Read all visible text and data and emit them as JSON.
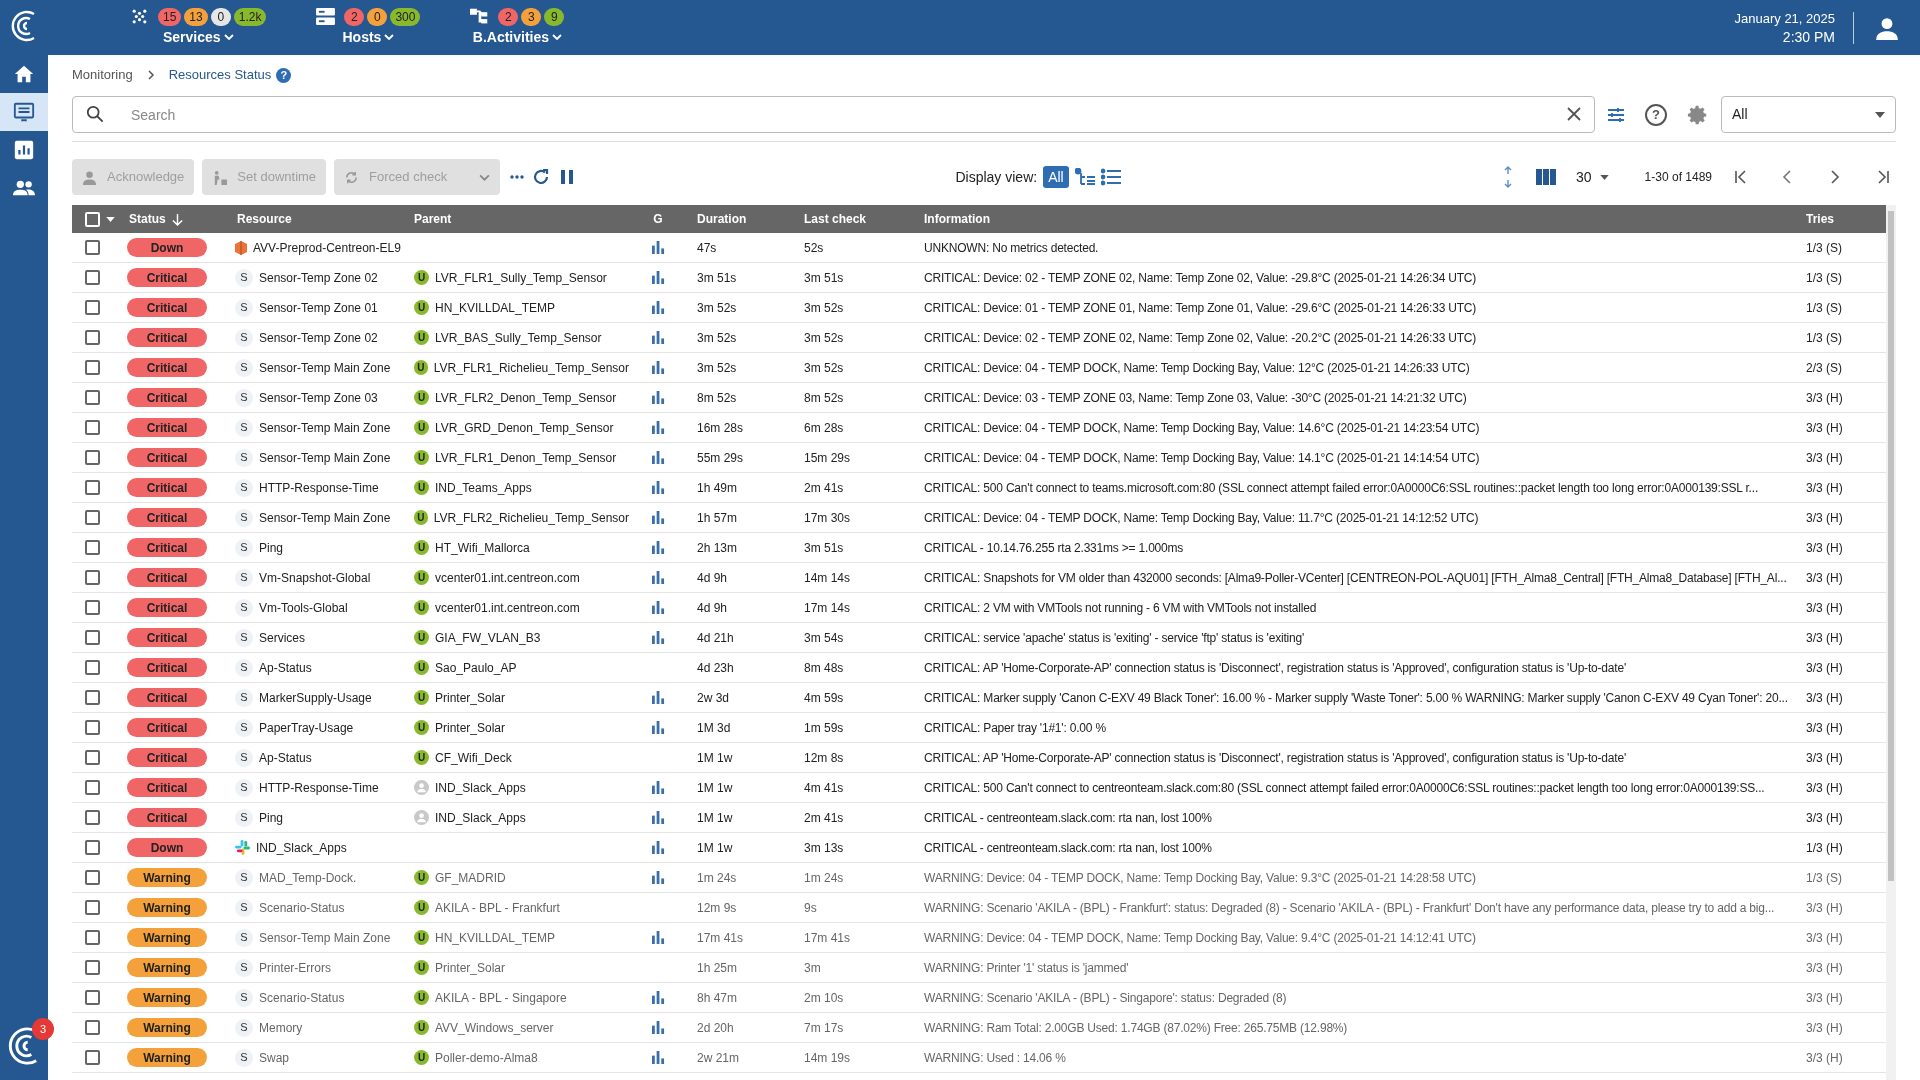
{
  "header": {
    "groups": [
      {
        "kind": "services",
        "label": "Services",
        "counters": [
          {
            "value": "15",
            "color": "#f06565"
          },
          {
            "value": "13",
            "color": "#f5a13b"
          },
          {
            "value": "0",
            "color": "#e6e6e6"
          },
          {
            "value": "1.2k",
            "color": "#88b92c"
          }
        ]
      },
      {
        "kind": "hosts",
        "label": "Hosts",
        "counters": [
          {
            "value": "2",
            "color": "#f06565"
          },
          {
            "value": "0",
            "color": "#f5a13b"
          },
          {
            "value": "300",
            "color": "#88b92c"
          }
        ]
      },
      {
        "kind": "activities",
        "label": "B.Activities",
        "counters": [
          {
            "value": "2",
            "color": "#f06565"
          },
          {
            "value": "3",
            "color": "#f5a13b"
          },
          {
            "value": "9",
            "color": "#88b92c"
          }
        ]
      }
    ],
    "date": "January 21, 2025",
    "time": "2:30 PM"
  },
  "sidebar": {
    "items": [
      {
        "kind": "home",
        "selected": false
      },
      {
        "kind": "monitoring",
        "selected": true
      },
      {
        "kind": "reporting",
        "selected": false
      },
      {
        "kind": "users",
        "selected": false
      }
    ],
    "badge": "3"
  },
  "breadcrumb": {
    "items": [
      "Monitoring",
      "Resources Status"
    ],
    "help": "?"
  },
  "search": {
    "placeholder": "Search",
    "help": "?",
    "filter": "All"
  },
  "actions": [
    "Acknowledge",
    "Set downtime",
    "Forced check"
  ],
  "display_view": {
    "label": "Display view:",
    "options": [
      {
        "kind": "all",
        "label": "All",
        "selected": true
      },
      {
        "kind": "tree",
        "selected": false
      },
      {
        "kind": "list",
        "selected": false
      }
    ]
  },
  "pagination": {
    "per_page": "30",
    "range": "1-30 of 1489"
  },
  "table": {
    "select_all": {
      "checked": false
    },
    "columns": [
      "Status",
      "Resource",
      "Parent",
      "G",
      "Duration",
      "Last check",
      "Information",
      "Tries"
    ],
    "rows": [
      {
        "checked": false,
        "status": {
          "label": "Down",
          "color": "#f06565"
        },
        "resource": {
          "kind": "host",
          "name": "AVV-Preprod-Centreon-EL9"
        },
        "graph": true,
        "duration": "47s",
        "last_check": "52s",
        "information": "UNKNOWN: No metrics detected.",
        "tries": "1/3 (S)"
      },
      {
        "checked": false,
        "status": {
          "label": "Critical",
          "color": "#f06565"
        },
        "resource": {
          "kind": "service",
          "badge": "S",
          "name": "Sensor-Temp Zone 02"
        },
        "parent": {
          "kind": "up",
          "badge": "U",
          "name": "LVR_FLR1_Sully_Temp_Sensor"
        },
        "graph": true,
        "duration": "3m 51s",
        "last_check": "3m 51s",
        "information": "CRITICAL: Device: 02 - TEMP ZONE 02, Name: Temp Zone 02, Value: -29.8°C (2025-01-21 14:26:34 UTC)",
        "tries": "1/3 (S)"
      },
      {
        "checked": false,
        "status": {
          "label": "Critical",
          "color": "#f06565"
        },
        "resource": {
          "kind": "service",
          "badge": "S",
          "name": "Sensor-Temp Zone 01"
        },
        "parent": {
          "kind": "up",
          "badge": "U",
          "name": "HN_KVILLDAL_TEMP"
        },
        "graph": true,
        "duration": "3m 52s",
        "last_check": "3m 52s",
        "information": "CRITICAL: Device: 01 - TEMP ZONE 01, Name: Temp Zone 01, Value: -29.6°C (2025-01-21 14:26:33 UTC)",
        "tries": "1/3 (S)"
      },
      {
        "checked": false,
        "status": {
          "label": "Critical",
          "color": "#f06565"
        },
        "resource": {
          "kind": "service",
          "badge": "S",
          "name": "Sensor-Temp Zone 02"
        },
        "parent": {
          "kind": "up",
          "badge": "U",
          "name": "LVR_BAS_Sully_Temp_Sensor"
        },
        "graph": true,
        "duration": "3m 52s",
        "last_check": "3m 52s",
        "information": "CRITICAL: Device: 02 - TEMP ZONE 02, Name: Temp Zone 02, Value: -20.2°C (2025-01-21 14:26:33 UTC)",
        "tries": "1/3 (S)"
      },
      {
        "checked": false,
        "status": {
          "label": "Critical",
          "color": "#f06565"
        },
        "resource": {
          "kind": "service",
          "badge": "S",
          "name": "Sensor-Temp Main Zone"
        },
        "parent": {
          "kind": "up",
          "badge": "U",
          "name": "LVR_FLR1_Richelieu_Temp_Sensor"
        },
        "graph": true,
        "duration": "3m 52s",
        "last_check": "3m 52s",
        "information": "CRITICAL: Device: 04 - TEMP DOCK, Name: Temp Docking Bay, Value: 12°C (2025-01-21 14:26:33 UTC)",
        "tries": "2/3 (S)"
      },
      {
        "checked": false,
        "status": {
          "label": "Critical",
          "color": "#f06565"
        },
        "resource": {
          "kind": "service",
          "badge": "S",
          "name": "Sensor-Temp Zone 03"
        },
        "parent": {
          "kind": "up",
          "badge": "U",
          "name": "LVR_FLR2_Denon_Temp_Sensor"
        },
        "graph": true,
        "duration": "8m 52s",
        "last_check": "8m 52s",
        "information": "CRITICAL: Device: 03 - TEMP ZONE 03, Name: Temp Zone 03, Value: -30°C (2025-01-21 14:21:32 UTC)",
        "tries": "3/3 (H)"
      },
      {
        "checked": false,
        "status": {
          "label": "Critical",
          "color": "#f06565"
        },
        "resource": {
          "kind": "service",
          "badge": "S",
          "name": "Sensor-Temp Main Zone"
        },
        "parent": {
          "kind": "up",
          "badge": "U",
          "name": "LVR_GRD_Denon_Temp_Sensor"
        },
        "graph": true,
        "duration": "16m 28s",
        "last_check": "6m 28s",
        "information": "CRITICAL: Device: 04 - TEMP DOCK, Name: Temp Docking Bay, Value: 14.6°C (2025-01-21 14:23:54 UTC)",
        "tries": "3/3 (H)"
      },
      {
        "checked": false,
        "status": {
          "label": "Critical",
          "color": "#f06565"
        },
        "resource": {
          "kind": "service",
          "badge": "S",
          "name": "Sensor-Temp Main Zone"
        },
        "parent": {
          "kind": "up",
          "badge": "U",
          "name": "LVR_FLR1_Denon_Temp_Sensor"
        },
        "graph": true,
        "duration": "55m 29s",
        "last_check": "15m 29s",
        "information": "CRITICAL: Device: 04 - TEMP DOCK, Name: Temp Docking Bay, Value: 14.1°C (2025-01-21 14:14:54 UTC)",
        "tries": "3/3 (H)"
      },
      {
        "checked": false,
        "status": {
          "label": "Critical",
          "color": "#f06565"
        },
        "resource": {
          "kind": "service",
          "badge": "S",
          "name": "HTTP-Response-Time"
        },
        "parent": {
          "kind": "up",
          "badge": "U",
          "name": "IND_Teams_Apps"
        },
        "graph": true,
        "duration": "1h 49m",
        "last_check": "2m 41s",
        "information": "CRITICAL: 500 Can't connect to teams.microsoft.com:80 (SSL connect attempt failed error:0A0000C6:SSL routines::packet length too long error:0A000139:SSL r...",
        "tries": "3/3 (H)"
      },
      {
        "checked": false,
        "status": {
          "label": "Critical",
          "color": "#f06565"
        },
        "resource": {
          "kind": "service",
          "badge": "S",
          "name": "Sensor-Temp Main Zone"
        },
        "parent": {
          "kind": "up",
          "badge": "U",
          "name": "LVR_FLR2_Richelieu_Temp_Sensor"
        },
        "graph": true,
        "duration": "1h 57m",
        "last_check": "17m 30s",
        "information": "CRITICAL: Device: 04 - TEMP DOCK, Name: Temp Docking Bay, Value: 11.7°C (2025-01-21 14:12:52 UTC)",
        "tries": "3/3 (H)"
      },
      {
        "checked": false,
        "status": {
          "label": "Critical",
          "color": "#f06565"
        },
        "resource": {
          "kind": "service",
          "badge": "S",
          "name": "Ping"
        },
        "parent": {
          "kind": "up",
          "badge": "U",
          "name": "HT_Wifi_Mallorca"
        },
        "graph": true,
        "duration": "2h 13m",
        "last_check": "3m 51s",
        "information": "CRITICAL - 10.14.76.255 rta 2.331ms >= 1.000ms",
        "tries": "3/3 (H)"
      },
      {
        "checked": false,
        "status": {
          "label": "Critical",
          "color": "#f06565"
        },
        "resource": {
          "kind": "service",
          "badge": "S",
          "name": "Vm-Snapshot-Global"
        },
        "parent": {
          "kind": "up",
          "badge": "U",
          "name": "vcenter01.int.centreon.com"
        },
        "graph": true,
        "duration": "4d 9h",
        "last_check": "14m 14s",
        "information": "CRITICAL: Snapshots for VM older than 432000 seconds: [Alma9-Poller-VCenter] [CENTREON-POL-AQU01] [FTH_Alma8_Central] [FTH_Alma8_Database] [FTH_Al...",
        "tries": "3/3 (H)"
      },
      {
        "checked": false,
        "status": {
          "label": "Critical",
          "color": "#f06565"
        },
        "resource": {
          "kind": "service",
          "badge": "S",
          "name": "Vm-Tools-Global"
        },
        "parent": {
          "kind": "up",
          "badge": "U",
          "name": "vcenter01.int.centreon.com"
        },
        "graph": true,
        "duration": "4d 9h",
        "last_check": "17m 14s",
        "information": "CRITICAL: 2 VM with VMTools not running - 6 VM with VMTools not installed",
        "tries": "3/3 (H)"
      },
      {
        "checked": false,
        "status": {
          "label": "Critical",
          "color": "#f06565"
        },
        "resource": {
          "kind": "service",
          "badge": "S",
          "name": "Services"
        },
        "parent": {
          "kind": "up",
          "badge": "U",
          "name": "GIA_FW_VLAN_B3"
        },
        "graph": true,
        "duration": "4d 21h",
        "last_check": "3m 54s",
        "information": "CRITICAL: service 'apache' status is 'exiting' - service 'ftp' status is 'exiting'",
        "tries": "3/3 (H)"
      },
      {
        "checked": false,
        "status": {
          "label": "Critical",
          "color": "#f06565"
        },
        "resource": {
          "kind": "service",
          "badge": "S",
          "name": "Ap-Status"
        },
        "parent": {
          "kind": "up",
          "badge": "U",
          "name": "Sao_Paulo_AP"
        },
        "graph": false,
        "duration": "4d 23h",
        "last_check": "8m 48s",
        "information": "CRITICAL: AP 'Home-Corporate-AP' connection status is 'Disconnect', registration status is 'Approved', configuration status is 'Up-to-date'",
        "tries": "3/3 (H)"
      },
      {
        "checked": false,
        "status": {
          "label": "Critical",
          "color": "#f06565"
        },
        "resource": {
          "kind": "service",
          "badge": "S",
          "name": "MarkerSupply-Usage"
        },
        "parent": {
          "kind": "up",
          "badge": "U",
          "name": "Printer_Solar"
        },
        "graph": true,
        "duration": "2w 3d",
        "last_check": "4m 59s",
        "information": "CRITICAL: Marker supply 'Canon C-EXV 49 Black Toner': 16.00 % - Marker supply 'Waste Toner': 5.00 % WARNING: Marker supply 'Canon C-EXV 49 Cyan Toner': 20...",
        "tries": "3/3 (H)"
      },
      {
        "checked": false,
        "status": {
          "label": "Critical",
          "color": "#f06565"
        },
        "resource": {
          "kind": "service",
          "badge": "S",
          "name": "PaperTray-Usage"
        },
        "parent": {
          "kind": "up",
          "badge": "U",
          "name": "Printer_Solar"
        },
        "graph": true,
        "duration": "1M 3d",
        "last_check": "1m 59s",
        "information": "CRITICAL: Paper tray '1#1': 0.00 %",
        "tries": "3/3 (H)"
      },
      {
        "checked": false,
        "status": {
          "label": "Critical",
          "color": "#f06565"
        },
        "resource": {
          "kind": "service",
          "badge": "S",
          "name": "Ap-Status"
        },
        "parent": {
          "kind": "up",
          "badge": "U",
          "name": "CF_Wifi_Deck"
        },
        "graph": false,
        "duration": "1M 1w",
        "last_check": "12m 8s",
        "information": "CRITICAL: AP 'Home-Corporate-AP' connection status is 'Disconnect', registration status is 'Approved', configuration status is 'Up-to-date'",
        "tries": "3/3 (H)"
      },
      {
        "checked": false,
        "status": {
          "label": "Critical",
          "color": "#f06565"
        },
        "resource": {
          "kind": "service",
          "badge": "S",
          "name": "HTTP-Response-Time"
        },
        "parent": {
          "kind": "pending",
          "name": "IND_Slack_Apps"
        },
        "graph": true,
        "duration": "1M 1w",
        "last_check": "4m 41s",
        "information": "CRITICAL: 500 Can't connect to centreonteam.slack.com:80 (SSL connect attempt failed error:0A0000C6:SSL routines::packet length too long error:0A000139:SS...",
        "tries": "3/3 (H)"
      },
      {
        "checked": false,
        "status": {
          "label": "Critical",
          "color": "#f06565"
        },
        "resource": {
          "kind": "service",
          "badge": "S",
          "name": "Ping"
        },
        "parent": {
          "kind": "pending",
          "name": "IND_Slack_Apps"
        },
        "graph": true,
        "duration": "1M 1w",
        "last_check": "2m 41s",
        "information": "CRITICAL - centreonteam.slack.com: rta nan, lost 100%",
        "tries": "3/3 (H)"
      },
      {
        "checked": false,
        "status": {
          "label": "Down",
          "color": "#f06565"
        },
        "resource": {
          "kind": "app",
          "name": "IND_Slack_Apps"
        },
        "graph": true,
        "duration": "1M 1w",
        "last_check": "3m 13s",
        "information": "CRITICAL - centreonteam.slack.com: rta nan, lost 100%",
        "tries": "1/3 (H)"
      },
      {
        "checked": false,
        "status": {
          "label": "Warning",
          "color": "#f5a13b"
        },
        "resource": {
          "kind": "service",
          "badge": "S",
          "name": "MAD_Temp-Dock."
        },
        "parent": {
          "kind": "up",
          "badge": "U",
          "name": "GF_MADRID"
        },
        "graph": true,
        "duration": "1m 24s",
        "last_check": "1m 24s",
        "information": "WARNING: Device: 04 - TEMP DOCK, Name: Temp Docking Bay, Value: 9.3°C (2025-01-21 14:28:58 UTC)",
        "tries": "1/3 (S)"
      },
      {
        "checked": false,
        "status": {
          "label": "Warning",
          "color": "#f5a13b"
        },
        "resource": {
          "kind": "service",
          "badge": "S",
          "name": "Scenario-Status"
        },
        "parent": {
          "kind": "up",
          "badge": "U",
          "name": "AKILA - BPL - Frankfurt"
        },
        "graph": false,
        "duration": "12m 9s",
        "last_check": "9s",
        "information": "WARNING: Scenario 'AKILA - (BPL) - Frankfurt': status: Degraded (8) - Scenario 'AKILA - (BPL) - Frankfurt' Don't have any performance data, please try to add a big...",
        "tries": "3/3 (H)"
      },
      {
        "checked": false,
        "status": {
          "label": "Warning",
          "color": "#f5a13b"
        },
        "resource": {
          "kind": "service",
          "badge": "S",
          "name": "Sensor-Temp Main Zone"
        },
        "parent": {
          "kind": "up",
          "badge": "U",
          "name": "HN_KVILLDAL_TEMP"
        },
        "graph": true,
        "duration": "17m 41s",
        "last_check": "17m 41s",
        "information": "WARNING: Device: 04 - TEMP DOCK, Name: Temp Docking Bay, Value: 9.4°C (2025-01-21 14:12:41 UTC)",
        "tries": "3/3 (H)"
      },
      {
        "checked": false,
        "status": {
          "label": "Warning",
          "color": "#f5a13b"
        },
        "resource": {
          "kind": "service",
          "badge": "S",
          "name": "Printer-Errors"
        },
        "parent": {
          "kind": "up",
          "badge": "U",
          "name": "Printer_Solar"
        },
        "graph": false,
        "duration": "1h 25m",
        "last_check": "3m",
        "information": "WARNING: Printer '1' status is 'jammed'",
        "tries": "3/3 (H)"
      },
      {
        "checked": false,
        "status": {
          "label": "Warning",
          "color": "#f5a13b"
        },
        "resource": {
          "kind": "service",
          "badge": "S",
          "name": "Scenario-Status"
        },
        "parent": {
          "kind": "up",
          "badge": "U",
          "name": "AKILA - BPL - Singapore"
        },
        "graph": true,
        "duration": "8h 47m",
        "last_check": "2m 10s",
        "information": "WARNING: Scenario 'AKILA - (BPL) - Singapore': status: Degraded (8)",
        "tries": "3/3 (H)"
      },
      {
        "checked": false,
        "status": {
          "label": "Warning",
          "color": "#f5a13b"
        },
        "resource": {
          "kind": "service",
          "badge": "S",
          "name": "Memory"
        },
        "parent": {
          "kind": "up",
          "badge": "U",
          "name": "AVV_Windows_server"
        },
        "graph": true,
        "duration": "2d 20h",
        "last_check": "7m 17s",
        "information": "WARNING: Ram Total: 2.00GB Used: 1.74GB (87.02%) Free: 265.75MB (12.98%)",
        "tries": "3/3 (H)"
      },
      {
        "checked": false,
        "status": {
          "label": "Warning",
          "color": "#f5a13b"
        },
        "resource": {
          "kind": "service",
          "badge": "S",
          "name": "Swap"
        },
        "parent": {
          "kind": "up",
          "badge": "U",
          "name": "Poller-demo-Alma8"
        },
        "graph": true,
        "duration": "2w 21m",
        "last_check": "14m 19s",
        "information": "WARNING: Used : 14.06 %",
        "tries": "3/3 (H)"
      }
    ]
  }
}
